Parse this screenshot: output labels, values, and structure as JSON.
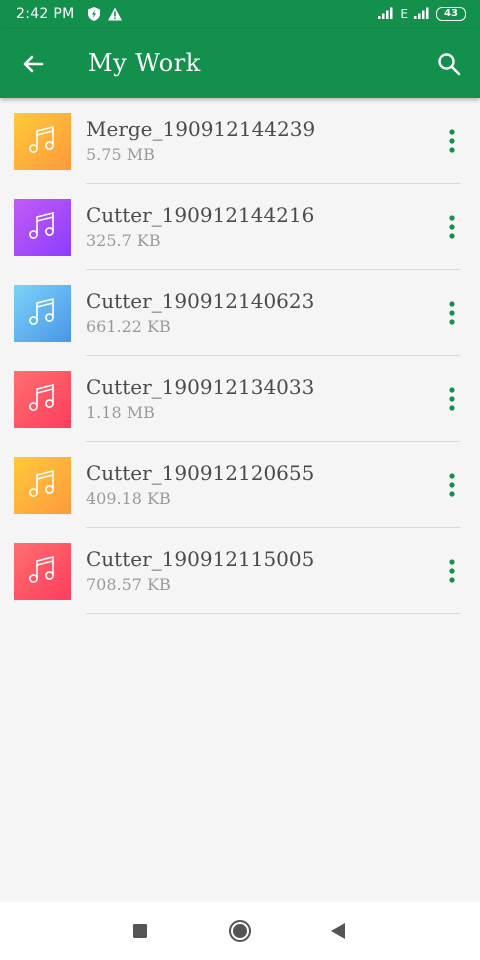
{
  "status_bar": {
    "time": "2:42 PM",
    "network_label": "E",
    "battery": "43",
    "icons": [
      "shield-icon",
      "warning-icon",
      "signal-icon",
      "battery-icon"
    ]
  },
  "app_bar": {
    "title": "My Work",
    "back_icon": "arrow-left-icon",
    "search_icon": "search-icon",
    "color": "#13904c"
  },
  "files": [
    {
      "name": "Merge_190912144239",
      "size": "5.75 MB",
      "icon": "music-note-icon",
      "gradient": [
        "#ffc93a",
        "#ff9a3c"
      ]
    },
    {
      "name": "Cutter_190912144216",
      "size": "325.7 KB",
      "icon": "music-note-icon",
      "gradient": [
        "#c35cf5",
        "#8a3dff"
      ]
    },
    {
      "name": "Cutter_190912140623",
      "size": "661.22 KB",
      "icon": "music-note-icon",
      "gradient": [
        "#7ad3f6",
        "#4a95e8"
      ]
    },
    {
      "name": "Cutter_190912134033",
      "size": "1.18 MB",
      "icon": "music-note-icon",
      "gradient": [
        "#ff6f6f",
        "#ff3d5e"
      ]
    },
    {
      "name": "Cutter_190912120655",
      "size": "409.18 KB",
      "icon": "music-note-icon",
      "gradient": [
        "#ffc93a",
        "#ff9a3c"
      ]
    },
    {
      "name": "Cutter_190912115005",
      "size": "708.57 KB",
      "icon": "music-note-icon",
      "gradient": [
        "#ff6f6f",
        "#ff3d5e"
      ]
    }
  ],
  "more_icon": "more-vert-icon",
  "accent_color": "#13904c",
  "nav_bar": {
    "buttons": [
      "recent-apps-icon",
      "home-icon",
      "back-triangle-icon"
    ]
  }
}
